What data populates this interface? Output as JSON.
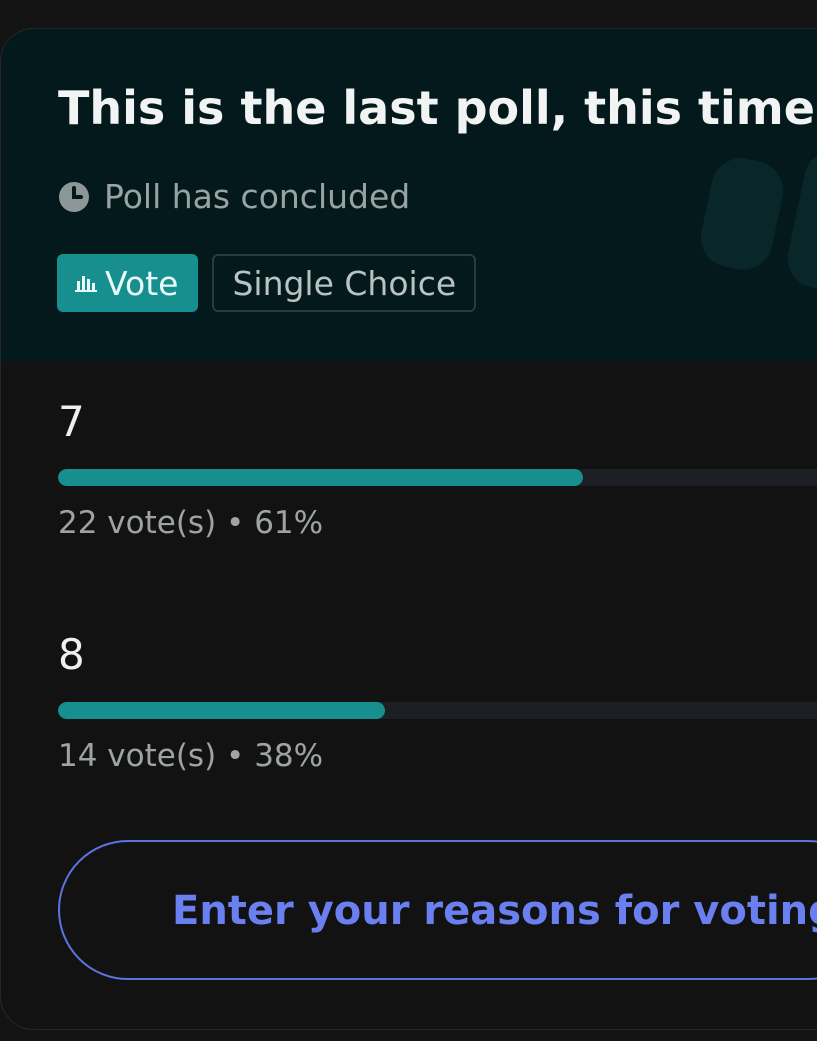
{
  "poll": {
    "title": "This is the last poll, this time fr",
    "status": "Poll has concluded",
    "tags": {
      "vote": "Vote",
      "choice_type": "Single Choice"
    },
    "options": [
      {
        "label": "7",
        "votes": "22 vote(s)",
        "separator": "•",
        "percent": "61%",
        "fraction": 0.61
      },
      {
        "label": "8",
        "votes": "14 vote(s)",
        "separator": "•",
        "percent": "38%",
        "fraction": 0.38
      }
    ],
    "reason_button": "Enter your reasons for voting"
  },
  "colors": {
    "accent": "#168f8e",
    "header_bg": "#04191b",
    "link": "#6b80f0"
  },
  "icons": {
    "status": "clock-icon",
    "vote_tag": "bar-chart-icon"
  }
}
